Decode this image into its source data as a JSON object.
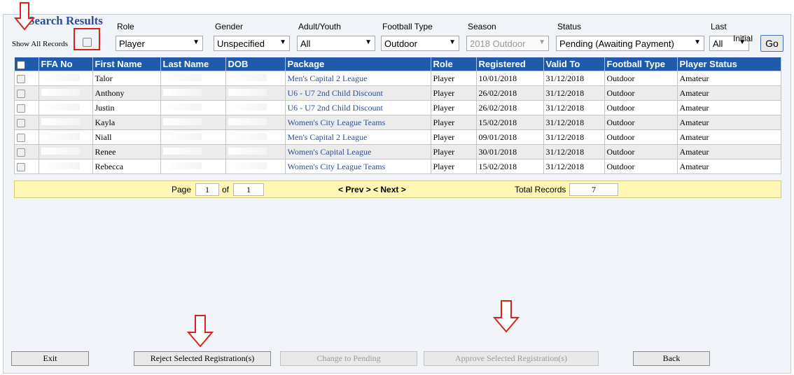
{
  "header": {
    "title": "Search Results",
    "show_all_label": "Show All Records"
  },
  "filters": {
    "role": {
      "label": "Role",
      "value": "Player"
    },
    "gender": {
      "label": "Gender",
      "value": "Unspecified"
    },
    "adult_youth": {
      "label": "Adult/Youth",
      "value": "All"
    },
    "football_type": {
      "label": "Football Type",
      "value": "Outdoor"
    },
    "season": {
      "label": "Season",
      "value": "2018 Outdoor"
    },
    "status": {
      "label": "Status",
      "value": "Pending (Awaiting Payment)"
    },
    "last_initial": {
      "label_line1": "Last",
      "label_line2": "Initial",
      "value": "All"
    },
    "go_label": "Go"
  },
  "table": {
    "columns": [
      "FFA No",
      "First Name",
      "Last Name",
      "DOB",
      "Package",
      "Role",
      "Registered",
      "Valid To",
      "Football Type",
      "Player Status"
    ],
    "rows": [
      {
        "first": "Talor",
        "package": "Men's Capital 2 League",
        "role": "Player",
        "registered": "10/01/2018",
        "valid_to": "31/12/2018",
        "football_type": "Outdoor",
        "status": "Amateur"
      },
      {
        "first": "Anthony",
        "package": "U6 - U7 2nd Child Discount",
        "role": "Player",
        "registered": "26/02/2018",
        "valid_to": "31/12/2018",
        "football_type": "Outdoor",
        "status": "Amateur"
      },
      {
        "first": "Justin",
        "package": "U6 - U7 2nd Child Discount",
        "role": "Player",
        "registered": "26/02/2018",
        "valid_to": "31/12/2018",
        "football_type": "Outdoor",
        "status": "Amateur"
      },
      {
        "first": "Kayla",
        "package": "Women's City League Teams",
        "role": "Player",
        "registered": "15/02/2018",
        "valid_to": "31/12/2018",
        "football_type": "Outdoor",
        "status": "Amateur"
      },
      {
        "first": "Niall",
        "package": "Men's Capital 2 League",
        "role": "Player",
        "registered": "09/01/2018",
        "valid_to": "31/12/2018",
        "football_type": "Outdoor",
        "status": "Amateur"
      },
      {
        "first": "Renee",
        "package": "Women's Capital League",
        "role": "Player",
        "registered": "30/01/2018",
        "valid_to": "31/12/2018",
        "football_type": "Outdoor",
        "status": "Amateur"
      },
      {
        "first": "Rebecca",
        "package": "Women's City League Teams",
        "role": "Player",
        "registered": "15/02/2018",
        "valid_to": "31/12/2018",
        "football_type": "Outdoor",
        "status": "Amateur"
      }
    ]
  },
  "pager": {
    "page_label": "Page",
    "page": "1",
    "of_label": "of",
    "total_pages": "1",
    "nav": "< Prev > < Next >",
    "total_label": "Total Records",
    "total": "7"
  },
  "buttons": {
    "exit": "Exit",
    "reject": "Reject Selected Registration(s)",
    "change_pending": "Change to Pending",
    "approve": "Approve Selected Registration(s)",
    "back": "Back"
  },
  "colors": {
    "header_blue": "#1f5aab",
    "pager_yellow": "#fff8b4",
    "annotation_red": "#d9241b"
  }
}
